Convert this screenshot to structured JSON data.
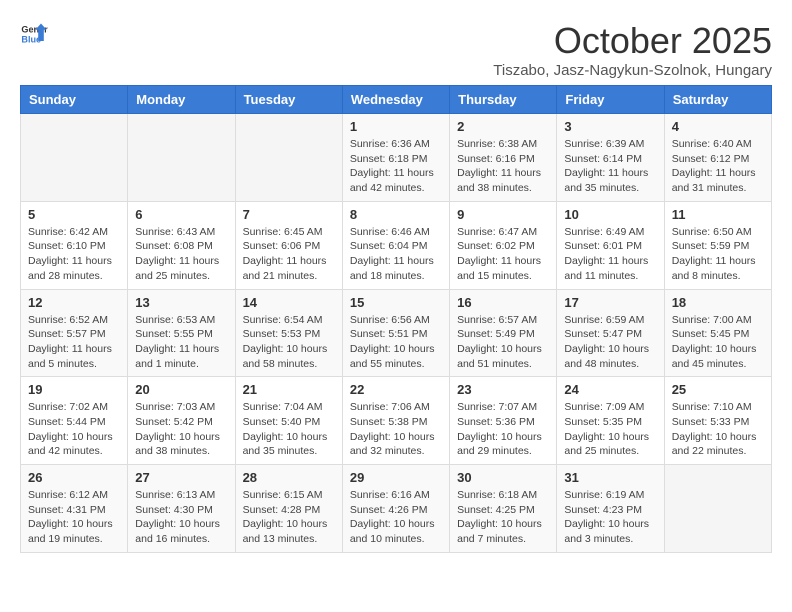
{
  "header": {
    "logo_general": "General",
    "logo_blue": "Blue",
    "month_title": "October 2025",
    "location": "Tiszabo, Jasz-Nagykun-Szolnok, Hungary"
  },
  "weekdays": [
    "Sunday",
    "Monday",
    "Tuesday",
    "Wednesday",
    "Thursday",
    "Friday",
    "Saturday"
  ],
  "weeks": [
    [
      {
        "day": "",
        "info": ""
      },
      {
        "day": "",
        "info": ""
      },
      {
        "day": "",
        "info": ""
      },
      {
        "day": "1",
        "info": "Sunrise: 6:36 AM\nSunset: 6:18 PM\nDaylight: 11 hours\nand 42 minutes."
      },
      {
        "day": "2",
        "info": "Sunrise: 6:38 AM\nSunset: 6:16 PM\nDaylight: 11 hours\nand 38 minutes."
      },
      {
        "day": "3",
        "info": "Sunrise: 6:39 AM\nSunset: 6:14 PM\nDaylight: 11 hours\nand 35 minutes."
      },
      {
        "day": "4",
        "info": "Sunrise: 6:40 AM\nSunset: 6:12 PM\nDaylight: 11 hours\nand 31 minutes."
      }
    ],
    [
      {
        "day": "5",
        "info": "Sunrise: 6:42 AM\nSunset: 6:10 PM\nDaylight: 11 hours\nand 28 minutes."
      },
      {
        "day": "6",
        "info": "Sunrise: 6:43 AM\nSunset: 6:08 PM\nDaylight: 11 hours\nand 25 minutes."
      },
      {
        "day": "7",
        "info": "Sunrise: 6:45 AM\nSunset: 6:06 PM\nDaylight: 11 hours\nand 21 minutes."
      },
      {
        "day": "8",
        "info": "Sunrise: 6:46 AM\nSunset: 6:04 PM\nDaylight: 11 hours\nand 18 minutes."
      },
      {
        "day": "9",
        "info": "Sunrise: 6:47 AM\nSunset: 6:02 PM\nDaylight: 11 hours\nand 15 minutes."
      },
      {
        "day": "10",
        "info": "Sunrise: 6:49 AM\nSunset: 6:01 PM\nDaylight: 11 hours\nand 11 minutes."
      },
      {
        "day": "11",
        "info": "Sunrise: 6:50 AM\nSunset: 5:59 PM\nDaylight: 11 hours\nand 8 minutes."
      }
    ],
    [
      {
        "day": "12",
        "info": "Sunrise: 6:52 AM\nSunset: 5:57 PM\nDaylight: 11 hours\nand 5 minutes."
      },
      {
        "day": "13",
        "info": "Sunrise: 6:53 AM\nSunset: 5:55 PM\nDaylight: 11 hours\nand 1 minute."
      },
      {
        "day": "14",
        "info": "Sunrise: 6:54 AM\nSunset: 5:53 PM\nDaylight: 10 hours\nand 58 minutes."
      },
      {
        "day": "15",
        "info": "Sunrise: 6:56 AM\nSunset: 5:51 PM\nDaylight: 10 hours\nand 55 minutes."
      },
      {
        "day": "16",
        "info": "Sunrise: 6:57 AM\nSunset: 5:49 PM\nDaylight: 10 hours\nand 51 minutes."
      },
      {
        "day": "17",
        "info": "Sunrise: 6:59 AM\nSunset: 5:47 PM\nDaylight: 10 hours\nand 48 minutes."
      },
      {
        "day": "18",
        "info": "Sunrise: 7:00 AM\nSunset: 5:45 PM\nDaylight: 10 hours\nand 45 minutes."
      }
    ],
    [
      {
        "day": "19",
        "info": "Sunrise: 7:02 AM\nSunset: 5:44 PM\nDaylight: 10 hours\nand 42 minutes."
      },
      {
        "day": "20",
        "info": "Sunrise: 7:03 AM\nSunset: 5:42 PM\nDaylight: 10 hours\nand 38 minutes."
      },
      {
        "day": "21",
        "info": "Sunrise: 7:04 AM\nSunset: 5:40 PM\nDaylight: 10 hours\nand 35 minutes."
      },
      {
        "day": "22",
        "info": "Sunrise: 7:06 AM\nSunset: 5:38 PM\nDaylight: 10 hours\nand 32 minutes."
      },
      {
        "day": "23",
        "info": "Sunrise: 7:07 AM\nSunset: 5:36 PM\nDaylight: 10 hours\nand 29 minutes."
      },
      {
        "day": "24",
        "info": "Sunrise: 7:09 AM\nSunset: 5:35 PM\nDaylight: 10 hours\nand 25 minutes."
      },
      {
        "day": "25",
        "info": "Sunrise: 7:10 AM\nSunset: 5:33 PM\nDaylight: 10 hours\nand 22 minutes."
      }
    ],
    [
      {
        "day": "26",
        "info": "Sunrise: 6:12 AM\nSunset: 4:31 PM\nDaylight: 10 hours\nand 19 minutes."
      },
      {
        "day": "27",
        "info": "Sunrise: 6:13 AM\nSunset: 4:30 PM\nDaylight: 10 hours\nand 16 minutes."
      },
      {
        "day": "28",
        "info": "Sunrise: 6:15 AM\nSunset: 4:28 PM\nDaylight: 10 hours\nand 13 minutes."
      },
      {
        "day": "29",
        "info": "Sunrise: 6:16 AM\nSunset: 4:26 PM\nDaylight: 10 hours\nand 10 minutes."
      },
      {
        "day": "30",
        "info": "Sunrise: 6:18 AM\nSunset: 4:25 PM\nDaylight: 10 hours\nand 7 minutes."
      },
      {
        "day": "31",
        "info": "Sunrise: 6:19 AM\nSunset: 4:23 PM\nDaylight: 10 hours\nand 3 minutes."
      },
      {
        "day": "",
        "info": ""
      }
    ]
  ]
}
